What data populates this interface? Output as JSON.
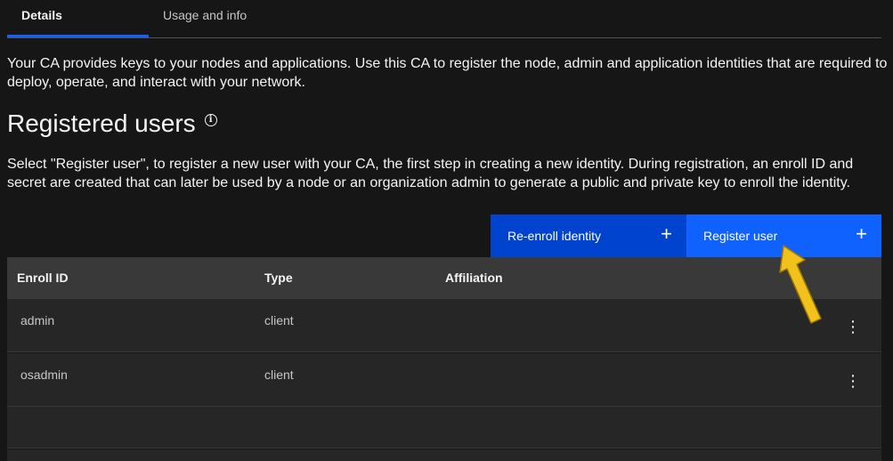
{
  "tabs": {
    "details": "Details",
    "usage": "Usage and info"
  },
  "intro_text": "Your CA provides keys to your nodes and applications. Use this CA to register the node, admin and application identities that are required to deploy, operate, and interact with your network.",
  "section": {
    "title": "Registered users",
    "description": "Select \"Register user\", to register a new user with your CA, the first step in creating a new identity. During registration, an enroll ID and secret are created that can later be used by a node or an organization admin to generate a public and private key to enroll the identity."
  },
  "buttons": {
    "reenroll": "Re-enroll identity",
    "register": "Register user",
    "plus": "+"
  },
  "table": {
    "headers": [
      "Enroll ID",
      "Type",
      "Affiliation"
    ],
    "rows": [
      {
        "enroll_id": "admin",
        "type": "client",
        "affiliation": ""
      },
      {
        "enroll_id": "osadmin",
        "type": "client",
        "affiliation": ""
      }
    ]
  },
  "overflow_glyph": "⋮",
  "colors": {
    "background": "#161616",
    "primary_button": "#0f62fe",
    "secondary_button": "#0043ce",
    "table_header": "#393939",
    "table_row": "#262626",
    "annotation_arrow": "#f1c21b"
  }
}
